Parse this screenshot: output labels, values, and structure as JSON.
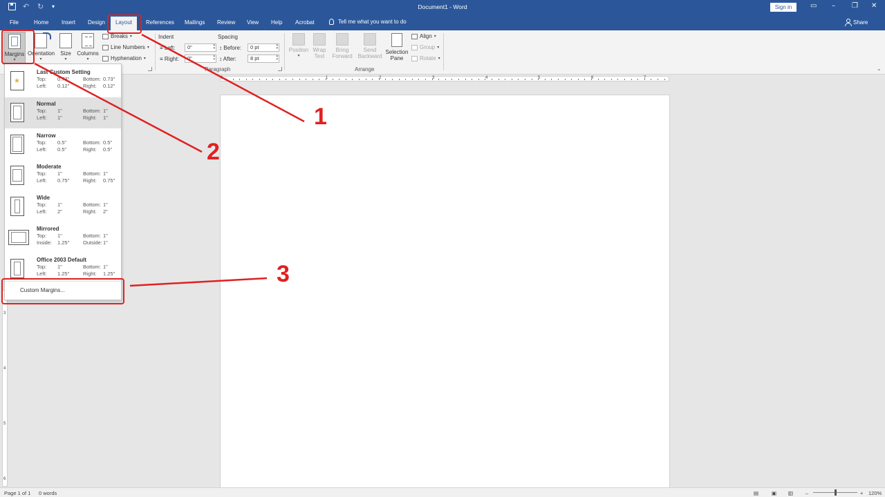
{
  "titlebar": {
    "title": "Document1 - Word",
    "signin": "Sign in",
    "icons": [
      "save-icon",
      "undo-icon",
      "redo-icon",
      "customize-quick-access-icon"
    ]
  },
  "tabs": [
    "File",
    "Home",
    "Insert",
    "Design",
    "Layout",
    "References",
    "Mailings",
    "Review",
    "View",
    "Help",
    "Acrobat"
  ],
  "active_tab": "Layout",
  "tellme": "Tell me what you want to do",
  "share": "Share",
  "ribbon": {
    "page_setup": {
      "margins": "Margins",
      "orientation": "Orientation",
      "size": "Size",
      "columns": "Columns",
      "breaks": "Breaks",
      "line_numbers": "Line Numbers",
      "hyphenation": "Hyphenation"
    },
    "paragraph": {
      "group_label": "Paragraph",
      "indent_label": "Indent",
      "spacing_label": "Spacing",
      "left_label": "Left:",
      "left_value": "0\"",
      "right_label": "Right:",
      "right_value": "0\"",
      "before_label": "Before:",
      "before_value": "0 pt",
      "after_label": "After:",
      "after_value": "8 pt"
    },
    "arrange": {
      "group_label": "Arrange",
      "position": "Position",
      "wrap_text_1": "Wrap",
      "wrap_text_2": "Text",
      "bring_forward_1": "Bring",
      "bring_forward_2": "Forward",
      "send_backward_1": "Send",
      "send_backward_2": "Backward",
      "selection_pane_1": "Selection",
      "selection_pane_2": "Pane",
      "align": "Align",
      "group": "Group",
      "rotate": "Rotate"
    }
  },
  "margins_menu": {
    "items": [
      {
        "name": "Last Custom Setting",
        "l1": "Top:",
        "v1": "0.73\"",
        "l2": "Bottom:",
        "v2": "0.73\"",
        "l3": "Left:",
        "v3": "0.12\"",
        "l4": "Right:",
        "v4": "0.12\""
      },
      {
        "name": "Normal",
        "l1": "Top:",
        "v1": "1\"",
        "l2": "Bottom:",
        "v2": "1\"",
        "l3": "Left:",
        "v3": "1\"",
        "l4": "Right:",
        "v4": "1\""
      },
      {
        "name": "Narrow",
        "l1": "Top:",
        "v1": "0.5\"",
        "l2": "Bottom:",
        "v2": "0.5\"",
        "l3": "Left:",
        "v3": "0.5\"",
        "l4": "Right:",
        "v4": "0.5\""
      },
      {
        "name": "Moderate",
        "l1": "Top:",
        "v1": "1\"",
        "l2": "Bottom:",
        "v2": "1\"",
        "l3": "Left:",
        "v3": "0.75\"",
        "l4": "Right:",
        "v4": "0.75\""
      },
      {
        "name": "Wide",
        "l1": "Top:",
        "v1": "1\"",
        "l2": "Bottom:",
        "v2": "1\"",
        "l3": "Left:",
        "v3": "2\"",
        "l4": "Right:",
        "v4": "2\""
      },
      {
        "name": "Mirrored",
        "l1": "Top:",
        "v1": "1\"",
        "l2": "Bottom:",
        "v2": "1\"",
        "l3": "Inside:",
        "v3": "1.25\"",
        "l4": "Outside:",
        "v4": "1\""
      },
      {
        "name": "Office 2003 Default",
        "l1": "Top:",
        "v1": "1\"",
        "l2": "Bottom:",
        "v2": "1\"",
        "l3": "Left:",
        "v3": "1.25\"",
        "l4": "Right:",
        "v4": "1.25\""
      }
    ],
    "selected_index": 1,
    "custom": "Custom Margins..."
  },
  "ruler": {
    "h_numbers": [
      "1",
      "1",
      "2",
      "3",
      "4",
      "5",
      "6",
      "7"
    ],
    "v_numbers": [
      "3",
      "4",
      "5",
      "6"
    ]
  },
  "status": {
    "page": "Page 1 of 1",
    "words": "0 words",
    "zoom": "120%"
  },
  "annotations": {
    "labels": [
      "1",
      "2",
      "3"
    ],
    "color": "#e02020"
  },
  "colors": {
    "brand": "#2b579a",
    "ribbon_bg": "#f3f3f3",
    "canvas_bg": "#e6e6e6"
  }
}
